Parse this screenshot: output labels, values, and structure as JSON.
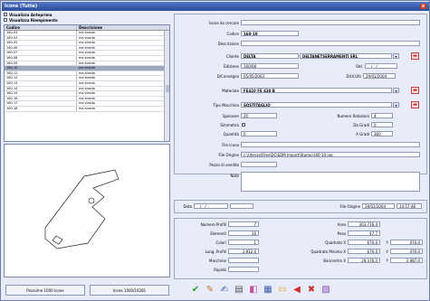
{
  "window": {
    "title": "Icone (Tutte)",
    "close_label": "x"
  },
  "toggles": {
    "visualizza_anteprima": "Visualizza Anteprima",
    "visualizza_riempimento": "Visualizza Riempimento"
  },
  "table": {
    "headers": [
      "Codice",
      "Descrizione"
    ],
    "rows": [
      [
        "160-03",
        "ma strada"
      ],
      [
        "160-04",
        "ma strada"
      ],
      [
        "160-05",
        "ma strada"
      ],
      [
        "160-06",
        "ma strada"
      ],
      [
        "160-07",
        "ma strada"
      ],
      [
        "160-08",
        "ma strada"
      ],
      [
        "160-09",
        "ma strada"
      ],
      [
        "160-10",
        "ma strada"
      ],
      [
        "160-11",
        "ma strada"
      ],
      [
        "160-12",
        "ma strada"
      ],
      [
        "160-13",
        "ma strada"
      ],
      [
        "160-14",
        "ma strada"
      ],
      [
        "160-15",
        "ma strada"
      ],
      [
        "160-16",
        "ma strada"
      ],
      [
        "160-17",
        "ma strada"
      ],
      [
        "160-18",
        "ma strada"
      ]
    ],
    "selected_index": 7
  },
  "buttons": {
    "prossime": "Prossime 1000 Icone",
    "icone_count": "Icone 1000/16281"
  },
  "form": {
    "icona_da_cercare": {
      "label": "Icona da cercare",
      "value": ""
    },
    "codice": {
      "label": "Codice",
      "value": "160-10"
    },
    "descrizione": {
      "label": "Descrizione",
      "value": ""
    },
    "cliente": {
      "label": "Cliente",
      "value": "DELTA",
      "value2": "DELTANETSERRAMENTI SRL"
    },
    "edizione": {
      "label": "Edizione",
      "value": "160/08",
      "std_label": "Std.",
      "std_value": "__/__/____"
    },
    "d_consegna": {
      "label": "D/Consegna",
      "value": "05/05/2003",
      "dur_label": "D/Ul.Ulti",
      "dur_value": "29/01/2004"
    },
    "materiale": {
      "label": "Materiale",
      "value": "FE410  FE 430 B"
    },
    "tipo_macchina": {
      "label": "Tipo Macchina",
      "value": "SOSTITAGLIO"
    },
    "spessore": {
      "label": "Spessore",
      "value": "20",
      "right_label": "Numero Rotazioni",
      "right_value": "4"
    },
    "simmetria": {
      "label": "Simmetria",
      "right_label": "Da Gradi",
      "right_value": "0"
    },
    "quantita": {
      "label": "Quantità",
      "value": "0",
      "right_label": "A Gradi",
      "right_value": "360"
    },
    "file_icona": {
      "label": "File Icona",
      "value": ""
    },
    "file_origine": {
      "label": "File Origine",
      "value": "c:\\Utenze\\Files\\DC\\EDM Import\\Stamp\\160-10.iag"
    },
    "pezzo_di_vendita": {
      "label": "Pezzo di vendita",
      "value": ""
    },
    "note": {
      "label": "Note",
      "value": ""
    },
    "data": {
      "label": "Data",
      "value": "__/__/____"
    },
    "file_origine_date": {
      "label": "File Origine",
      "date": "29/01/2004",
      "time": "14:57:48"
    }
  },
  "stats": {
    "numero_profili": {
      "label": "Numero Profili",
      "value": "7"
    },
    "elementi": {
      "label": "Elementi",
      "value": "16"
    },
    "colori": {
      "label": "Colori",
      "value": "1"
    },
    "lung_profili": {
      "label": "Lung. Profili",
      "value": "2.812,0"
    },
    "macchine": {
      "label": "Macchine",
      "value": ""
    },
    "rapido": {
      "label": "Rapido",
      "value": ""
    },
    "area": {
      "label": "Area",
      "value": "303.716,4"
    },
    "peso": {
      "label": "Peso",
      "value": "47,7"
    },
    "quadrato_x": {
      "label": "Quadrato X",
      "value": "670,0",
      "y": "470,0"
    },
    "quadrato_minimo": {
      "label": "Quadrato Minimo X",
      "value": "670,0",
      "y": "470,0"
    },
    "baricentro": {
      "label": "Baricentro X",
      "value": "29.376,0",
      "y": "2.987,0"
    }
  },
  "toolbar_icons": [
    "check-icon",
    "tools-icon",
    "edit-icon",
    "print-icon",
    "layers-icon",
    "grid-icon",
    "folder-icon",
    "back-icon",
    "delete-icon",
    "export-icon"
  ]
}
